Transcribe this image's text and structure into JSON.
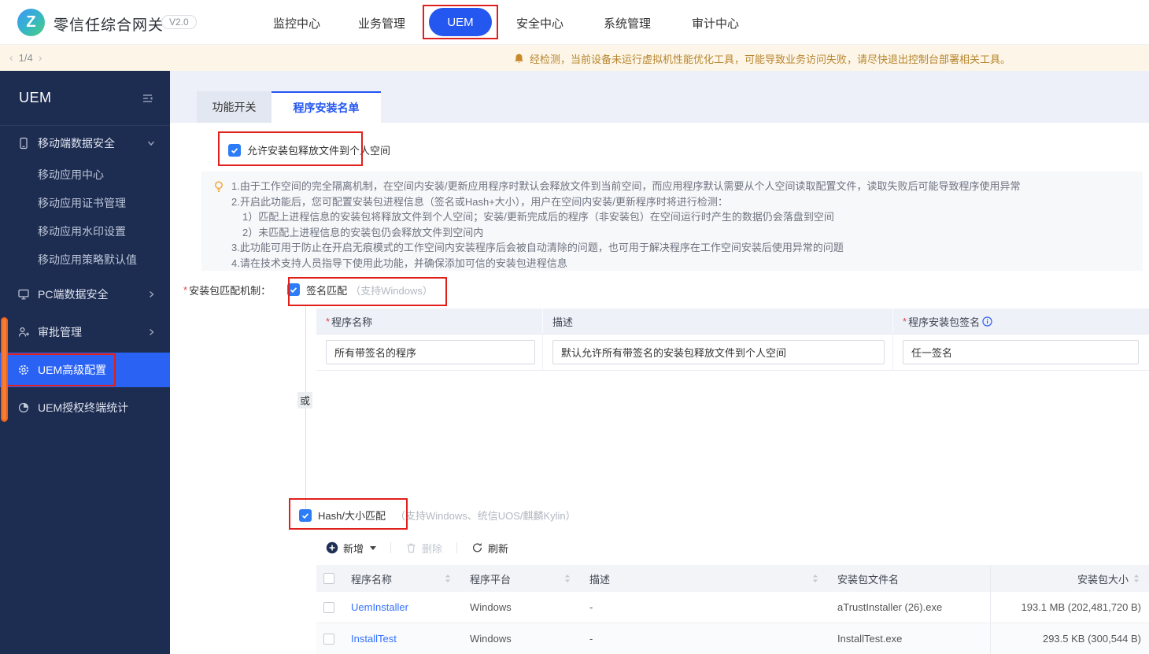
{
  "brand": {
    "product_name": "零信任综合网关",
    "version": "V2.0",
    "logo_letter": "Z"
  },
  "nav": {
    "items": [
      {
        "label": "监控中心",
        "active": false
      },
      {
        "label": "业务管理",
        "active": false
      },
      {
        "label": "UEM",
        "active": true
      },
      {
        "label": "安全中心",
        "active": false
      },
      {
        "label": "系统管理",
        "active": false
      },
      {
        "label": "审计中心",
        "active": false
      }
    ]
  },
  "banner": {
    "prev": "‹",
    "pager": "1/4",
    "next": "›",
    "message": "经检测，当前设备未运行虚拟机性能优化工具，可能导致业务访问失败，请尽快退出控制台部署相关工具。"
  },
  "sidebar": {
    "title": "UEM",
    "items": [
      {
        "label": "移动端数据安全",
        "icon": "mobile-icon",
        "expanded": true
      },
      {
        "label": "移动应用中心"
      },
      {
        "label": "移动应用证书管理"
      },
      {
        "label": "移动应用水印设置"
      },
      {
        "label": "移动应用策略默认值"
      },
      {
        "label": "PC端数据安全",
        "icon": "pc-icon"
      },
      {
        "label": "审批管理",
        "icon": "approval-icon"
      },
      {
        "label": "UEM高级配置",
        "icon": "gear-icon",
        "active": true
      },
      {
        "label": "UEM授权终端统计",
        "icon": "stats-icon"
      }
    ]
  },
  "tabs": {
    "function_switch": "功能开关",
    "install_list": "程序安装名单",
    "active_tab": "程序安装名单"
  },
  "main": {
    "required_mark": "*",
    "allow_label": "允许安装包释放文件到个人空间",
    "info_lines": [
      "1.由于工作空间的完全隔离机制，在空间内安装/更新应用程序时默认会释放文件到当前空间，而应用程序默认需要从个人空间读取配置文件，读取失败后可能导致程序使用异常",
      "2.开启此功能后，您可配置安装包进程信息（签名或Hash+大小），用户在空间内安装/更新程序时将进行检测：",
      "1）匹配上进程信息的安装包将释放文件到个人空间；安装/更新完成后的程序（非安装包）在空间运行时产生的数据仍会落盘到空间",
      "2）未匹配上进程信息的安装包仍会释放文件到空间内",
      "3.此功能可用于防止在开启无痕模式的工作空间内安装程序后会被自动清除的问题，也可用于解决程序在工作空间安装后使用异常的问题",
      "4.请在技术支持人员指导下使用此功能，并确保添加可信的安装包进程信息"
    ],
    "match_label": "安装包匹配机制：",
    "signature": {
      "label": "签名匹配",
      "hint": "（支持Windows）",
      "table": {
        "col_name": "程序名称",
        "col_desc": "描述",
        "col_sign": "程序安装包签名",
        "name_value": "所有带签名的程序",
        "desc_value": "默认允许所有带签名的安装包释放文件到个人空间",
        "sign_value": "任一签名"
      }
    },
    "or_label": "或",
    "hash": {
      "label": "Hash/大小匹配",
      "hint": "（支持Windows、统信UOS/麒麟Kylin）"
    },
    "toolbar": {
      "add": "新增",
      "delete": "删除",
      "refresh": "刷新"
    },
    "table": {
      "headers": [
        "程序名称",
        "程序平台",
        "描述",
        "安装包文件名",
        "安装包大小"
      ],
      "rows": [
        {
          "name": "UemInstaller",
          "platform": "Windows",
          "desc": "-",
          "file": "aTrustInstaller (26).exe",
          "size": "193.1 MB (202,481,720 B)"
        },
        {
          "name": "InstallTest",
          "platform": "Windows",
          "desc": "-",
          "file": "InstallTest.exe",
          "size": "293.5 KB (300,544 B)"
        }
      ]
    }
  },
  "colors": {
    "primary": "#2456f0",
    "checkbox": "#2b7cf6",
    "annotation_red": "#e0201c",
    "banner_bg": "#fdf6e8",
    "banner_text": "#b7852e",
    "sidebar_bg": "#1d2c51",
    "sidebar_active": "#2a62f4",
    "link": "#3370ff",
    "orange_strip": "#f67d35"
  }
}
